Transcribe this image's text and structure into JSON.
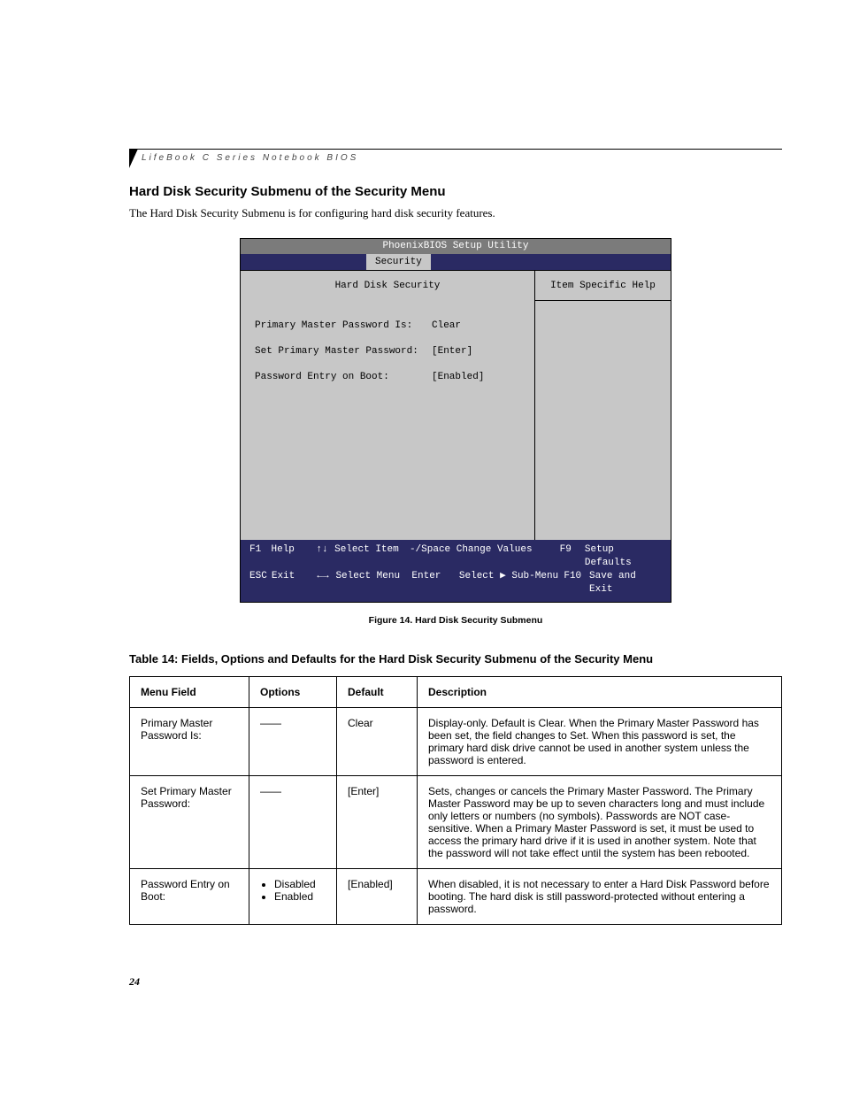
{
  "running_title": "LifeBook C Series Notebook BIOS",
  "section_heading": "Hard Disk Security Submenu of the Security Menu",
  "intro_text": "The Hard Disk Security Submenu is for configuring hard disk security features.",
  "figure_caption": "Figure 14.  Hard Disk Security Submenu",
  "table_title": "Table 14: Fields, Options and Defaults for the Hard Disk Security Submenu of the Security Menu",
  "page_number": "24",
  "bios": {
    "title": "PhoenixBIOS Setup Utility",
    "tab_label": "Security",
    "left_panel_title": "Hard Disk Security",
    "right_panel_title": "Item Specific Help",
    "rows": [
      {
        "label": "Primary Master Password Is:",
        "value": "Clear"
      },
      {
        "label": "Set Primary Master Password:",
        "value": "[Enter]"
      },
      {
        "label": "Password Entry on Boot:",
        "value": "[Enabled]"
      }
    ],
    "footer": {
      "r1": {
        "c1k": "F1",
        "c1": "Help",
        "c2k": "↑↓",
        "c2": "Select Item",
        "c3k": "-/Space",
        "c3": "Change Values",
        "c4k": "F9",
        "c4": "Setup Defaults"
      },
      "r2": {
        "c1k": "ESC",
        "c1": "Exit",
        "c2k": "←→",
        "c2": "Select Menu",
        "c3k": "Enter",
        "c3": "Select ▶ Sub-Menu",
        "c4k": "F10",
        "c4": "Save and Exit"
      }
    }
  },
  "table": {
    "headers": [
      "Menu Field",
      "Options",
      "Default",
      "Description"
    ],
    "rows": [
      {
        "field": "Primary Master Password Is:",
        "options_dash": "——",
        "default": "Clear",
        "desc": "Display-only. Default is Clear. When the Primary Master Password has been set, the field changes to Set. When this password is set, the primary hard disk drive cannot be used in another system unless the password is entered."
      },
      {
        "field": "Set Primary Master Password:",
        "options_dash": "——",
        "default": "[Enter]",
        "desc": "Sets, changes or cancels the Primary Master Password. The Primary Master Password may be up to seven characters long and must include only letters or numbers (no symbols). Passwords are NOT case-sensitive. When a Primary Master Password is set, it must be used to access the primary hard drive if it is used in another system. Note that the password will not take effect until the system has been rebooted."
      },
      {
        "field": "Password Entry on Boot:",
        "options": [
          "Disabled",
          "Enabled"
        ],
        "default": "[Enabled]",
        "desc": "When disabled, it is not necessary to enter a Hard Disk Password before booting. The hard disk is still password-protected without entering a password."
      }
    ]
  }
}
